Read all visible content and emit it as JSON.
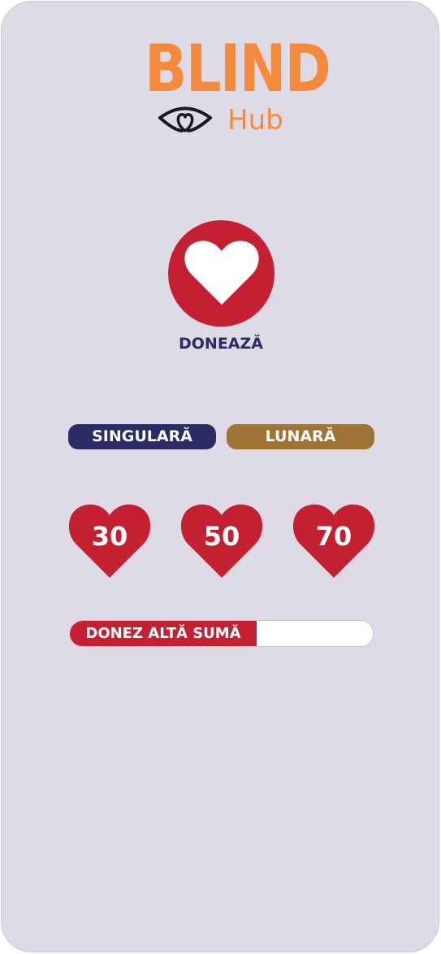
{
  "brand": {
    "word_1": "BLIND",
    "word_2": "Hub",
    "color": "#f68a3c",
    "icon": "eye-icon"
  },
  "donate": {
    "title": "DONEAZĂ",
    "icon": "heart-icon",
    "accent": "#c42032"
  },
  "frequency": {
    "single_label": "SINGULARĂ",
    "monthly_label": "LUNARĂ",
    "single_color": "#2a2c66",
    "monthly_color": "#a07336"
  },
  "amounts": [
    "30",
    "50",
    "70"
  ],
  "other_amount": {
    "label": "DONEZ ALTĂ SUMĂ",
    "value": ""
  }
}
